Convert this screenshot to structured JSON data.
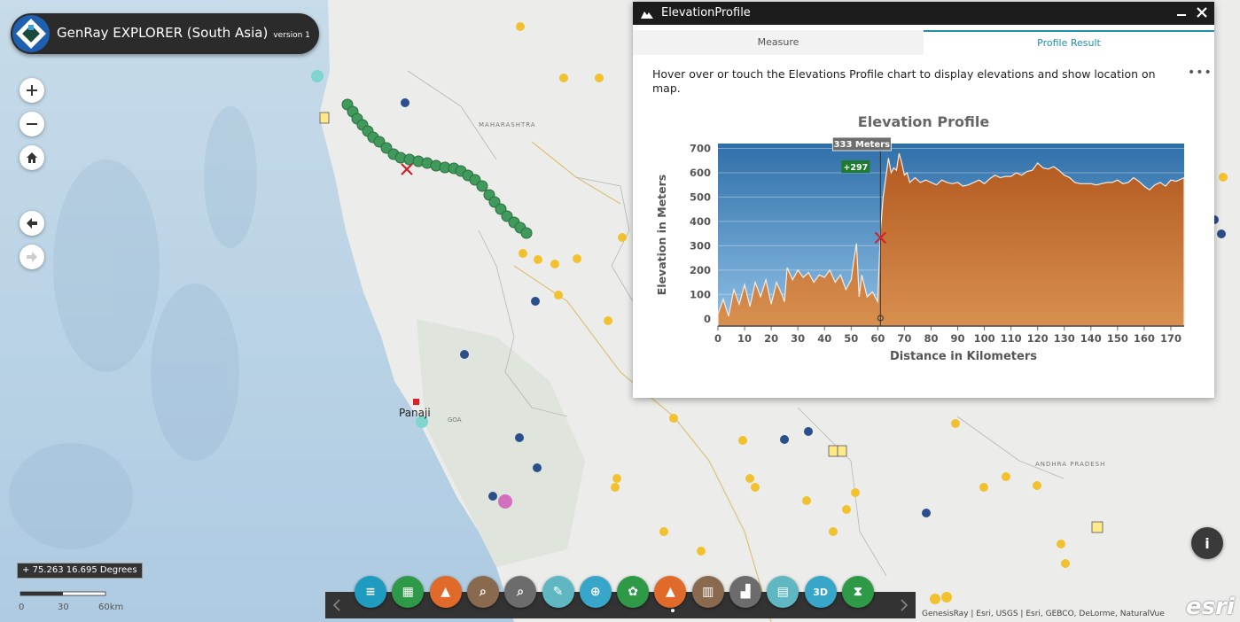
{
  "app": {
    "title": "GenRay EXPLORER (South Asia)",
    "version": "version 1"
  },
  "panel": {
    "title": "ElevationProfile",
    "tabs": [
      {
        "label": "Measure"
      },
      {
        "label": "Profile Result"
      }
    ],
    "active_tab": "Profile Result",
    "instructions": "Hover over or touch the Elevations Profile chart to display elevations and show location on map."
  },
  "chart_data": {
    "type": "area",
    "title": "Elevation Profile",
    "xlabel": "Distance in Kilometers",
    "ylabel": "Elevation in Meters",
    "xlim": [
      0,
      175
    ],
    "ylim": [
      -30,
      720
    ],
    "x_ticks": [
      "0",
      "10",
      "20",
      "30",
      "40",
      "50",
      "60",
      "70",
      "80",
      "90",
      "100",
      "110",
      "120",
      "130",
      "140",
      "150",
      "160",
      "170"
    ],
    "y_ticks": [
      "0",
      "100",
      "200",
      "300",
      "400",
      "500",
      "600",
      "700"
    ],
    "hover_label": "333 Meters",
    "hover_x": 61,
    "delta_label": "+297",
    "series": [
      {
        "x": [
          0,
          2,
          4,
          6,
          8,
          10,
          12,
          14,
          16,
          18,
          20,
          22,
          24,
          25,
          26,
          28,
          30,
          32,
          34,
          36,
          38,
          40,
          42,
          44,
          46,
          48,
          50,
          51,
          52,
          53,
          54,
          56,
          58,
          60,
          61,
          62,
          63,
          64,
          65,
          66,
          67,
          68,
          69,
          70,
          71,
          72,
          74,
          76,
          78,
          80,
          82,
          84,
          86,
          88,
          90,
          92,
          94,
          96,
          98,
          100,
          102,
          104,
          106,
          108,
          110,
          112,
          114,
          116,
          118,
          120,
          122,
          124,
          126,
          128,
          130,
          132,
          134,
          136,
          138,
          140,
          142,
          144,
          146,
          148,
          150,
          152,
          154,
          156,
          158,
          160,
          162,
          164,
          166,
          168,
          170,
          172,
          175
        ],
        "y": [
          20,
          80,
          10,
          120,
          60,
          140,
          50,
          150,
          90,
          160,
          60,
          150,
          100,
          70,
          210,
          160,
          200,
          170,
          190,
          150,
          180,
          170,
          200,
          150,
          180,
          120,
          160,
          240,
          310,
          90,
          180,
          90,
          110,
          70,
          360,
          500,
          580,
          660,
          600,
          620,
          610,
          680,
          640,
          590,
          600,
          560,
          580,
          560,
          570,
          560,
          550,
          570,
          560,
          555,
          560,
          545,
          550,
          560,
          570,
          555,
          575,
          590,
          580,
          585,
          585,
          600,
          590,
          605,
          610,
          640,
          620,
          615,
          625,
          610,
          590,
          580,
          560,
          555,
          555,
          555,
          550,
          555,
          560,
          560,
          570,
          555,
          560,
          580,
          565,
          545,
          530,
          550,
          560,
          545,
          570,
          565,
          580
        ]
      }
    ]
  },
  "map": {
    "labels": {
      "panaji": "Panaji",
      "maharashtra": "MAHARASHTRA",
      "goa": "GOA",
      "andhra": "ANDHRA PRADESH"
    },
    "coordinates": "75.263 16.695 Degrees",
    "scale_labels": [
      "0",
      "30",
      "60km"
    ],
    "attribution": "GenesisRay | Esri, USGS | Esri, GEBCO, DeLorme, NaturalVue",
    "esri_logo": "esri"
  },
  "toolbar": {
    "buttons": [
      {
        "name": "layers-icon",
        "color": "#1f9bbf"
      },
      {
        "name": "basemap-grid-icon",
        "color": "#2e9a48"
      },
      {
        "name": "chart-icon",
        "color": "#e06a2a"
      },
      {
        "name": "search-icon",
        "color": "#8a6a4f"
      },
      {
        "name": "query-icon",
        "color": "#6c6c6c"
      },
      {
        "name": "draw-icon",
        "color": "#5fb7c2"
      },
      {
        "name": "locate-icon",
        "color": "#37a6c8"
      },
      {
        "name": "film-icon",
        "color": "#2e9a48"
      },
      {
        "name": "elevation-profile-icon",
        "color": "#e06a2a"
      },
      {
        "name": "report-icon",
        "color": "#8a6a4f"
      },
      {
        "name": "building-icon",
        "color": "#6c6c6c"
      },
      {
        "name": "print-icon",
        "color": "#5fb7c2"
      },
      {
        "name": "3d-icon",
        "color": "#37a6c8",
        "label": "3D"
      },
      {
        "name": "timer-icon",
        "color": "#2e9a48"
      }
    ]
  },
  "colors": {
    "accent": "#1f8fb0",
    "chart_fill": "#c8733a",
    "chart_sky": "#3b7fb6"
  }
}
